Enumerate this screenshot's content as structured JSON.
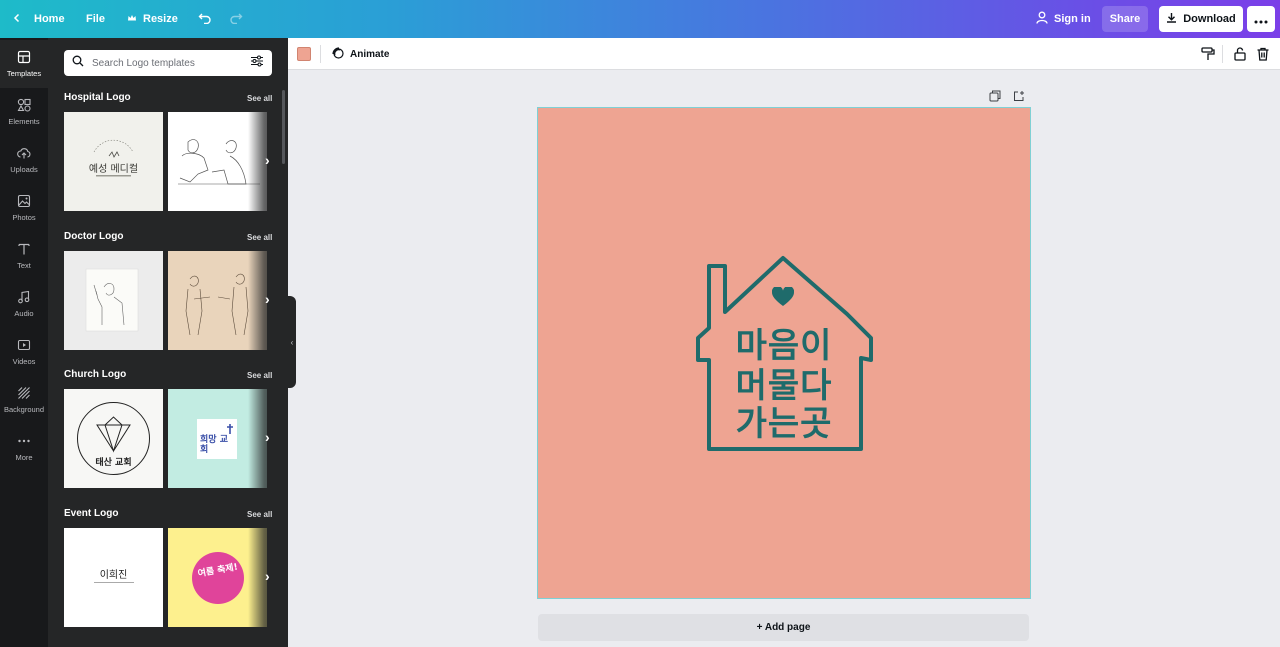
{
  "topbar": {
    "home_label": "Home",
    "file_label": "File",
    "resize_label": "Resize",
    "sign_in_label": "Sign in",
    "share_label": "Share",
    "download_label": "Download"
  },
  "rail": {
    "items": [
      {
        "label": "Templates",
        "icon": "templates-icon"
      },
      {
        "label": "Elements",
        "icon": "elements-icon"
      },
      {
        "label": "Uploads",
        "icon": "uploads-icon"
      },
      {
        "label": "Photos",
        "icon": "photos-icon"
      },
      {
        "label": "Text",
        "icon": "text-icon"
      },
      {
        "label": "Audio",
        "icon": "audio-icon"
      },
      {
        "label": "Videos",
        "icon": "videos-icon"
      },
      {
        "label": "Background",
        "icon": "background-icon"
      },
      {
        "label": "More",
        "icon": "more-icon"
      }
    ]
  },
  "panel": {
    "search_placeholder": "Search Logo templates",
    "sections": [
      {
        "title": "Hospital Logo",
        "see_all": "See all",
        "thumb_text": [
          "예성 메디컬",
          ""
        ]
      },
      {
        "title": "Doctor Logo",
        "see_all": "See all",
        "thumb_text": [
          "",
          ""
        ]
      },
      {
        "title": "Church Logo",
        "see_all": "See all",
        "thumb_text": [
          "태산 교회",
          "희망 교회"
        ]
      },
      {
        "title": "Event Logo",
        "see_all": "See all",
        "thumb_text": [
          "이희진",
          "여름 축제!"
        ]
      }
    ]
  },
  "toolbar": {
    "color_swatch": "#eea492",
    "animate_label": "Animate"
  },
  "design": {
    "background_color": "#eea492",
    "logo_color": "#1f6b6b",
    "logo_lines": [
      "마음이",
      "머물다",
      "가는곳"
    ]
  },
  "canvas": {
    "add_page_label": "+ Add page"
  }
}
